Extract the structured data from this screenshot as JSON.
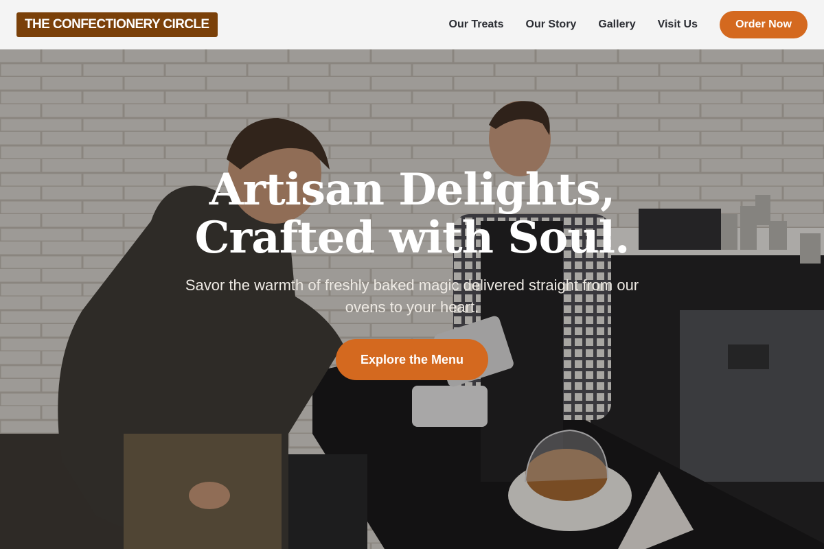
{
  "brand": {
    "name": "THE CONFECTIONERY CIRCLE"
  },
  "nav": {
    "links": [
      "Our Treats",
      "Our Story",
      "Gallery",
      "Visit Us"
    ],
    "cta": "Order Now"
  },
  "hero": {
    "title_line1": "Artisan Delights,",
    "title_line2": "Crafted with Soul.",
    "subtitle": "Savor the warmth of freshly baked magic delivered straight from our ovens to your heart.",
    "cta": "Explore the Menu"
  },
  "colors": {
    "accent": "#d4691f",
    "brand": "#7a4009",
    "nav_background": "#f4f4f4",
    "nav_text": "#2b2d33"
  }
}
